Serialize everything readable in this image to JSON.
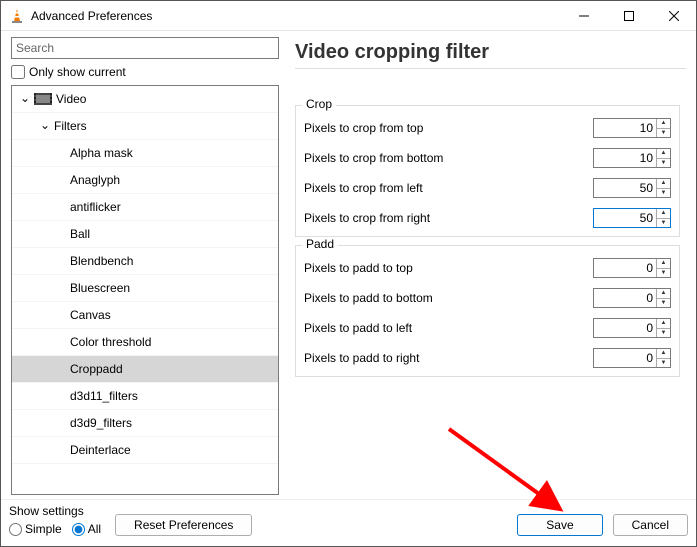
{
  "window": {
    "title": "Advanced Preferences"
  },
  "search": {
    "placeholder": "Search"
  },
  "only_show_current": {
    "label": "Only show current",
    "checked": false
  },
  "panel_title": "Video cropping filter",
  "tree": {
    "root": {
      "label": "Video",
      "expanded": true
    },
    "filters": {
      "label": "Filters",
      "expanded": true
    },
    "items": [
      {
        "label": "Alpha mask"
      },
      {
        "label": "Anaglyph"
      },
      {
        "label": "antiflicker"
      },
      {
        "label": "Ball"
      },
      {
        "label": "Blendbench"
      },
      {
        "label": "Bluescreen"
      },
      {
        "label": "Canvas"
      },
      {
        "label": "Color threshold"
      },
      {
        "label": "Croppadd",
        "selected": true
      },
      {
        "label": "d3d11_filters"
      },
      {
        "label": "d3d9_filters"
      },
      {
        "label": "Deinterlace"
      }
    ]
  },
  "groups": {
    "crop": {
      "legend": "Crop",
      "fields": [
        {
          "label": "Pixels to crop from top",
          "value": "10"
        },
        {
          "label": "Pixels to crop from bottom",
          "value": "10"
        },
        {
          "label": "Pixels to crop from left",
          "value": "50"
        },
        {
          "label": "Pixels to crop from right",
          "value": "50",
          "focused": true
        }
      ]
    },
    "padd": {
      "legend": "Padd",
      "fields": [
        {
          "label": "Pixels to padd to top",
          "value": "0"
        },
        {
          "label": "Pixels to padd to bottom",
          "value": "0"
        },
        {
          "label": "Pixels to padd to left",
          "value": "0"
        },
        {
          "label": "Pixels to padd to right",
          "value": "0"
        }
      ]
    }
  },
  "footer": {
    "show_settings_label": "Show settings",
    "radio_simple": "Simple",
    "radio_all": "All",
    "selected_radio": "all",
    "reset": "Reset Preferences",
    "save": "Save",
    "cancel": "Cancel"
  }
}
